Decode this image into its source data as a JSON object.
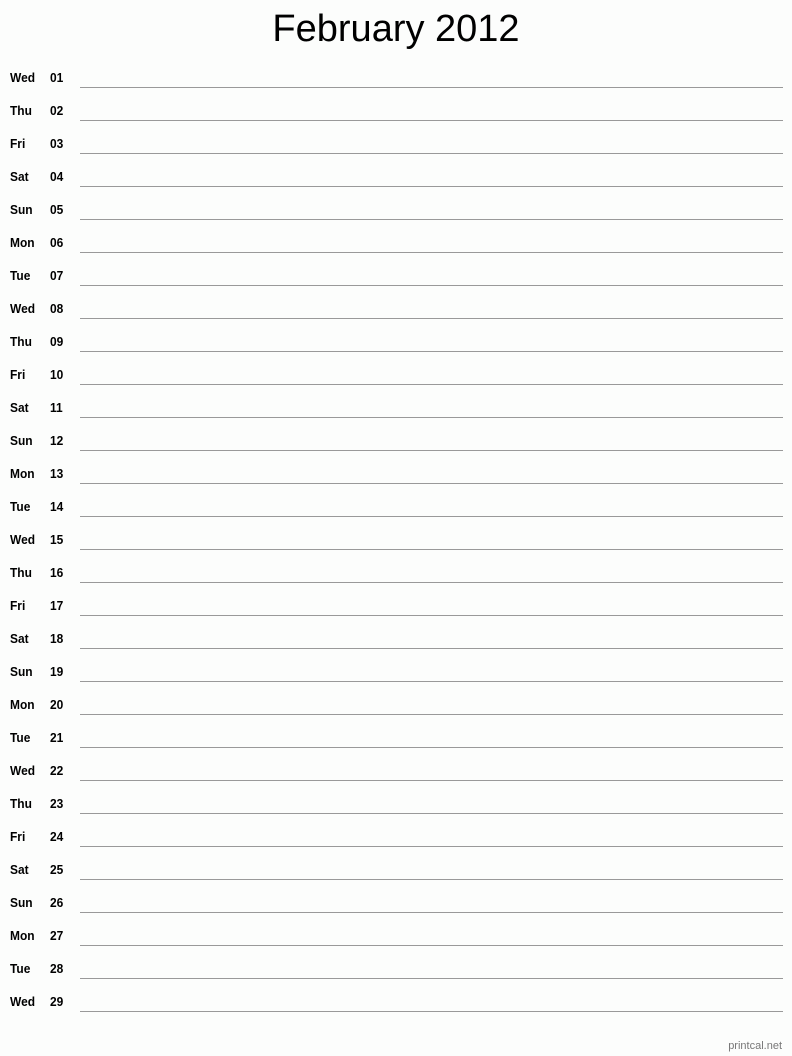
{
  "title": "February 2012",
  "days": [
    {
      "dow": "Wed",
      "day": "01"
    },
    {
      "dow": "Thu",
      "day": "02"
    },
    {
      "dow": "Fri",
      "day": "03"
    },
    {
      "dow": "Sat",
      "day": "04"
    },
    {
      "dow": "Sun",
      "day": "05"
    },
    {
      "dow": "Mon",
      "day": "06"
    },
    {
      "dow": "Tue",
      "day": "07"
    },
    {
      "dow": "Wed",
      "day": "08"
    },
    {
      "dow": "Thu",
      "day": "09"
    },
    {
      "dow": "Fri",
      "day": "10"
    },
    {
      "dow": "Sat",
      "day": "11"
    },
    {
      "dow": "Sun",
      "day": "12"
    },
    {
      "dow": "Mon",
      "day": "13"
    },
    {
      "dow": "Tue",
      "day": "14"
    },
    {
      "dow": "Wed",
      "day": "15"
    },
    {
      "dow": "Thu",
      "day": "16"
    },
    {
      "dow": "Fri",
      "day": "17"
    },
    {
      "dow": "Sat",
      "day": "18"
    },
    {
      "dow": "Sun",
      "day": "19"
    },
    {
      "dow": "Mon",
      "day": "20"
    },
    {
      "dow": "Tue",
      "day": "21"
    },
    {
      "dow": "Wed",
      "day": "22"
    },
    {
      "dow": "Thu",
      "day": "23"
    },
    {
      "dow": "Fri",
      "day": "24"
    },
    {
      "dow": "Sat",
      "day": "25"
    },
    {
      "dow": "Sun",
      "day": "26"
    },
    {
      "dow": "Mon",
      "day": "27"
    },
    {
      "dow": "Tue",
      "day": "28"
    },
    {
      "dow": "Wed",
      "day": "29"
    }
  ],
  "footer": "printcal.net"
}
